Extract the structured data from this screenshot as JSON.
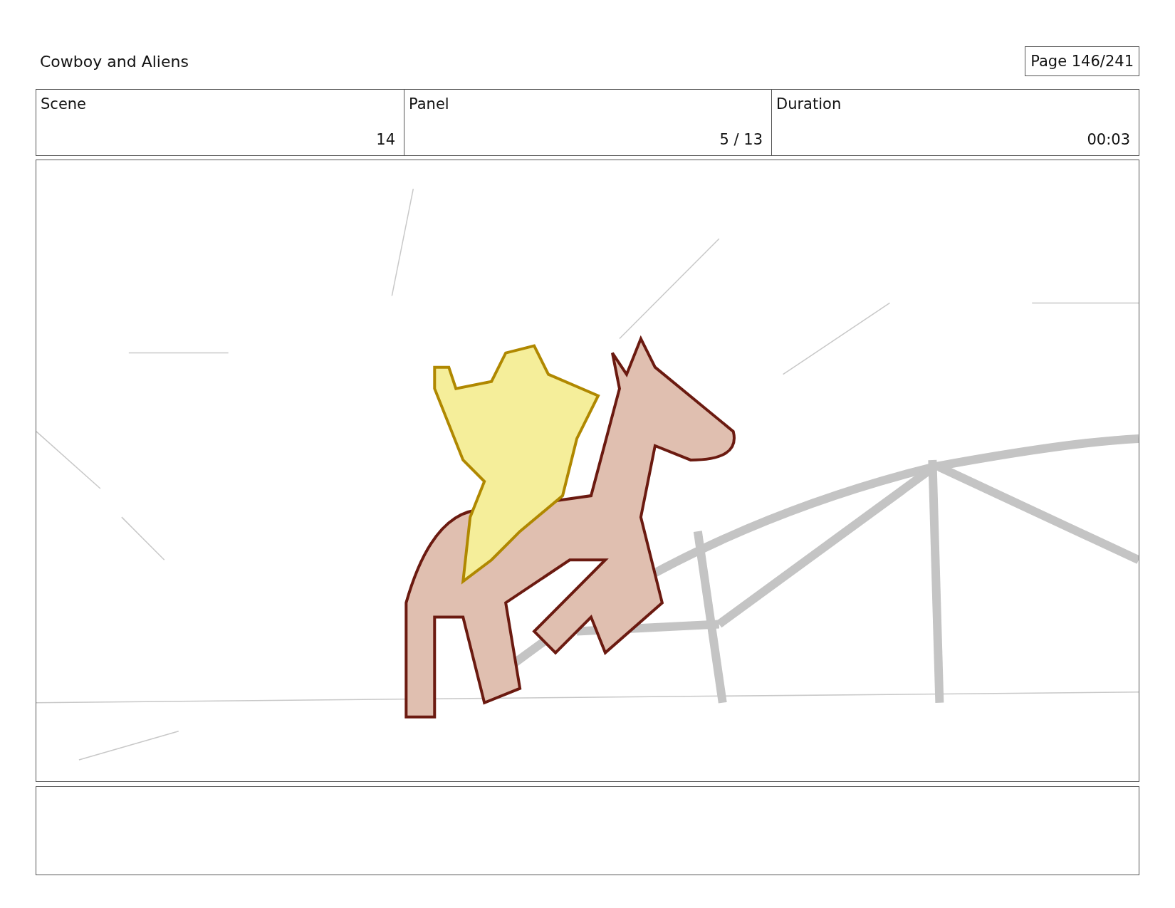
{
  "title": "Cowboy and Aliens",
  "page": "Page 146/241",
  "fields": [
    {
      "label": "Scene",
      "value": "14"
    },
    {
      "label": "Panel",
      "value": "5 / 13"
    },
    {
      "label": "Duration",
      "value": "00:03"
    }
  ],
  "panel": {
    "kind": "sketch"
  }
}
